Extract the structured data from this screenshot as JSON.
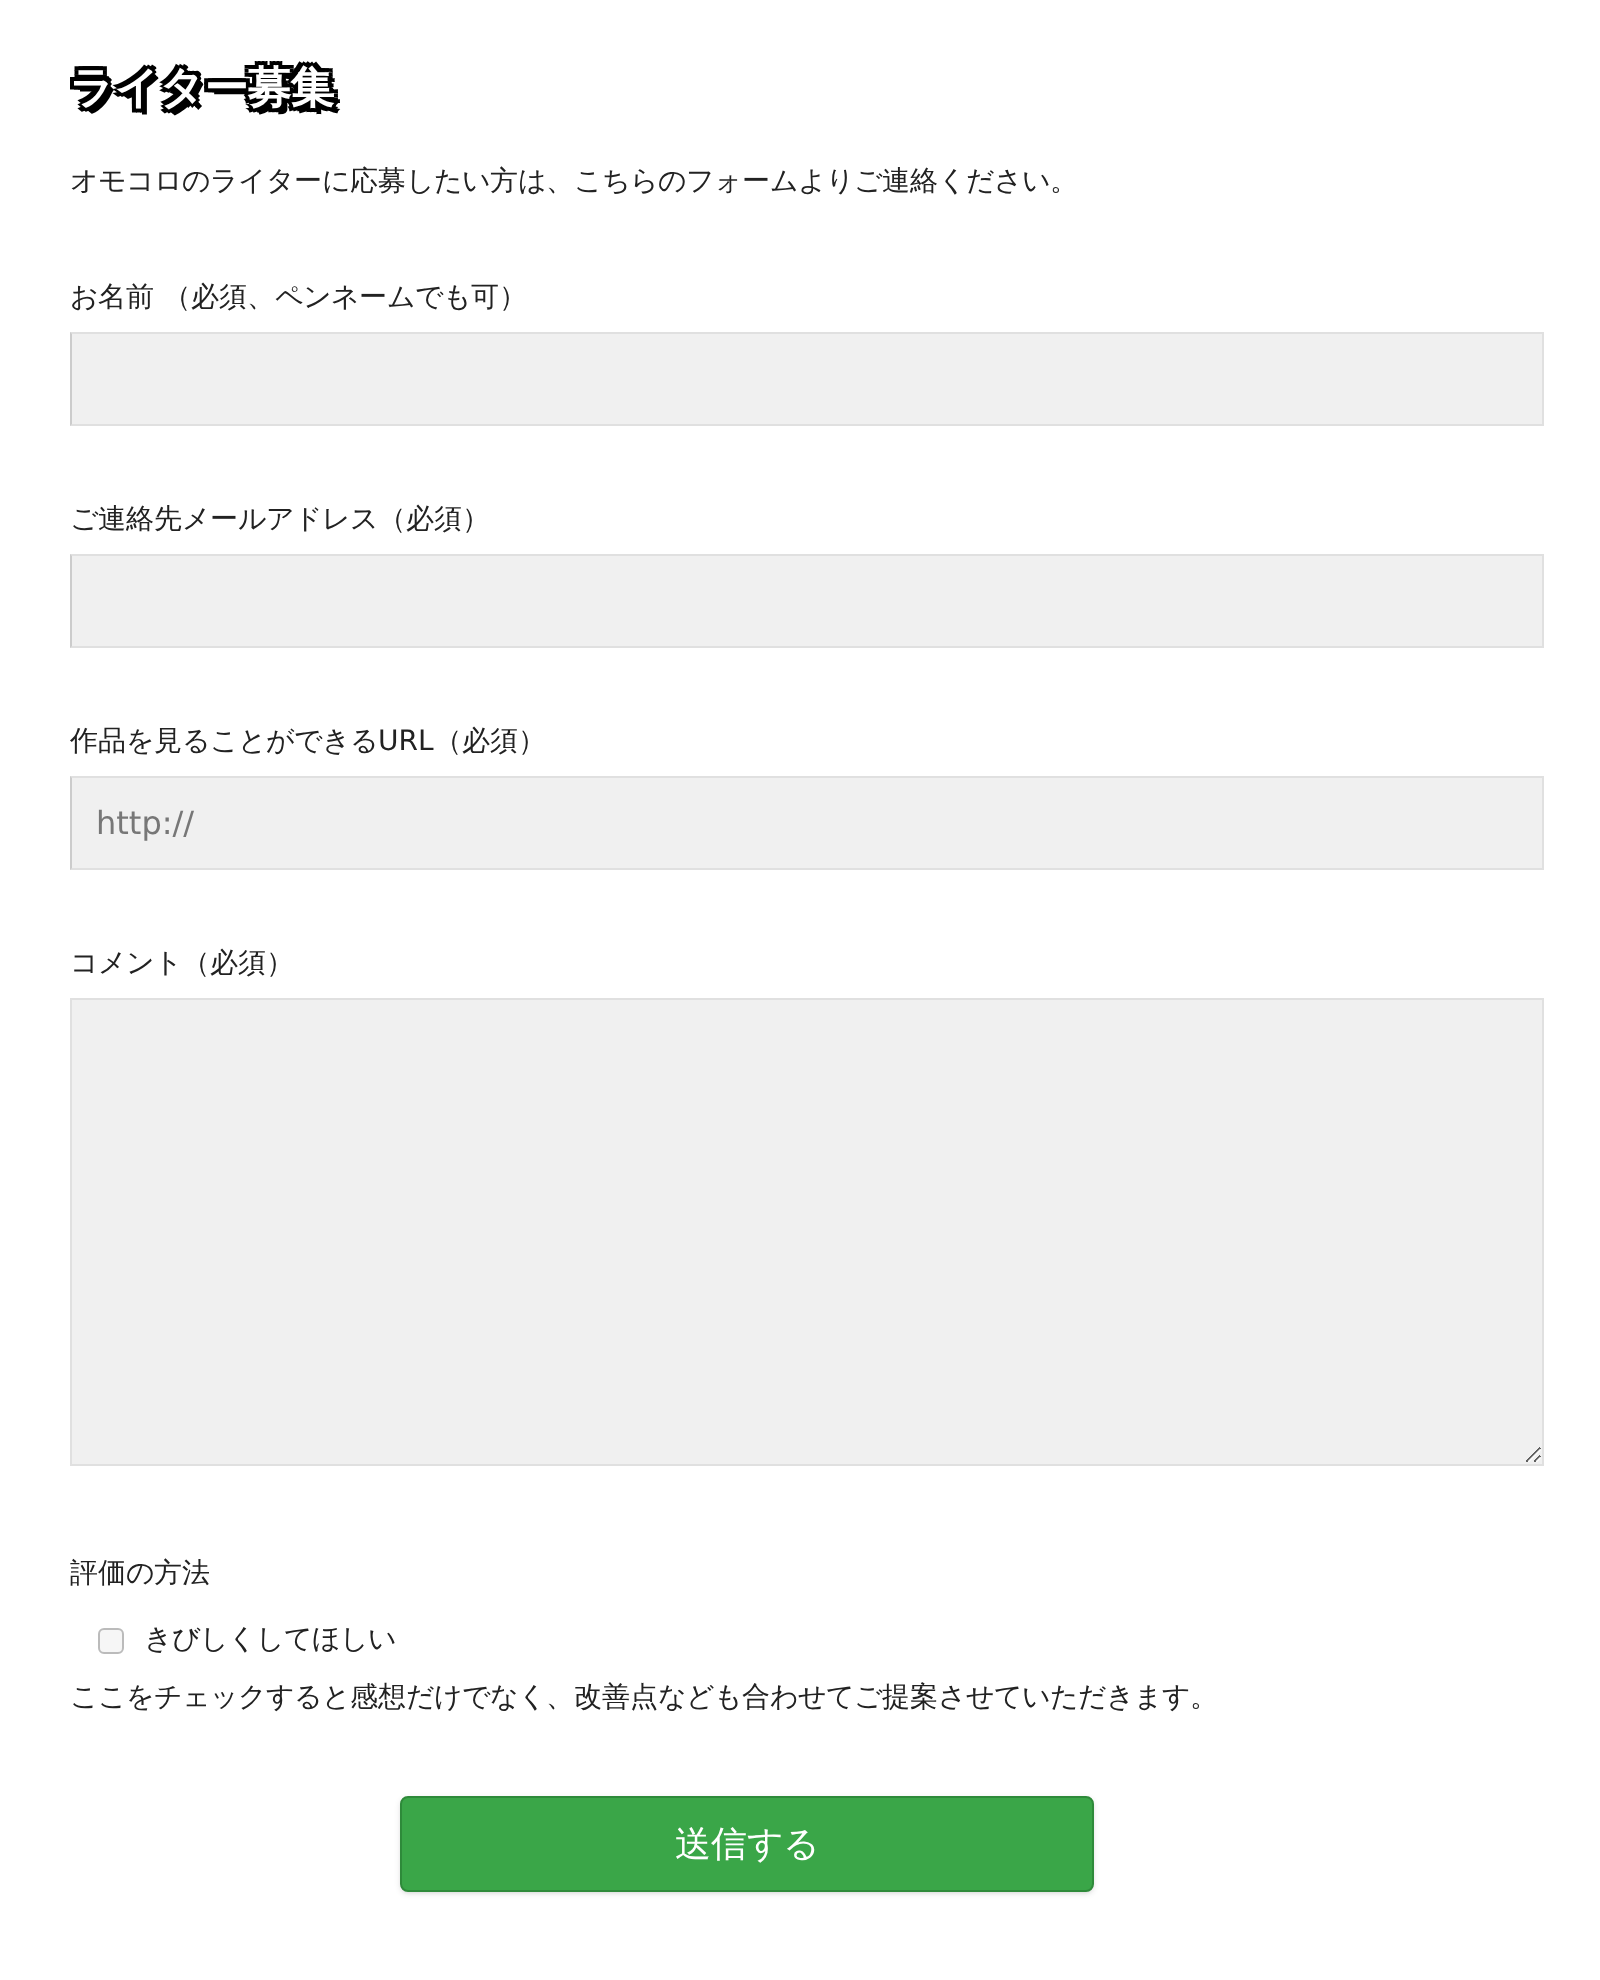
{
  "title": "ライター募集",
  "intro": "オモコロのライターに応募したい方は、こちらのフォームよりご連絡ください。",
  "fields": [
    {
      "kind": "input",
      "label": "お名前 （必須、ペンネームでも可）"
    },
    {
      "kind": "input",
      "label": "ご連絡先メールアドレス（必須）"
    },
    {
      "kind": "input",
      "label": "作品を見ることができるURL（必須）",
      "placeholder": "http://"
    },
    {
      "kind": "textarea",
      "label": "コメント（必須）"
    }
  ],
  "rating": {
    "label": "評価の方法",
    "option": {
      "label": "きびしくしてほしい",
      "checked": false
    },
    "note": "ここをチェックすると感想だけでなく、改善点なども合わせてご提案させていただきます。"
  },
  "submit": "送信する"
}
